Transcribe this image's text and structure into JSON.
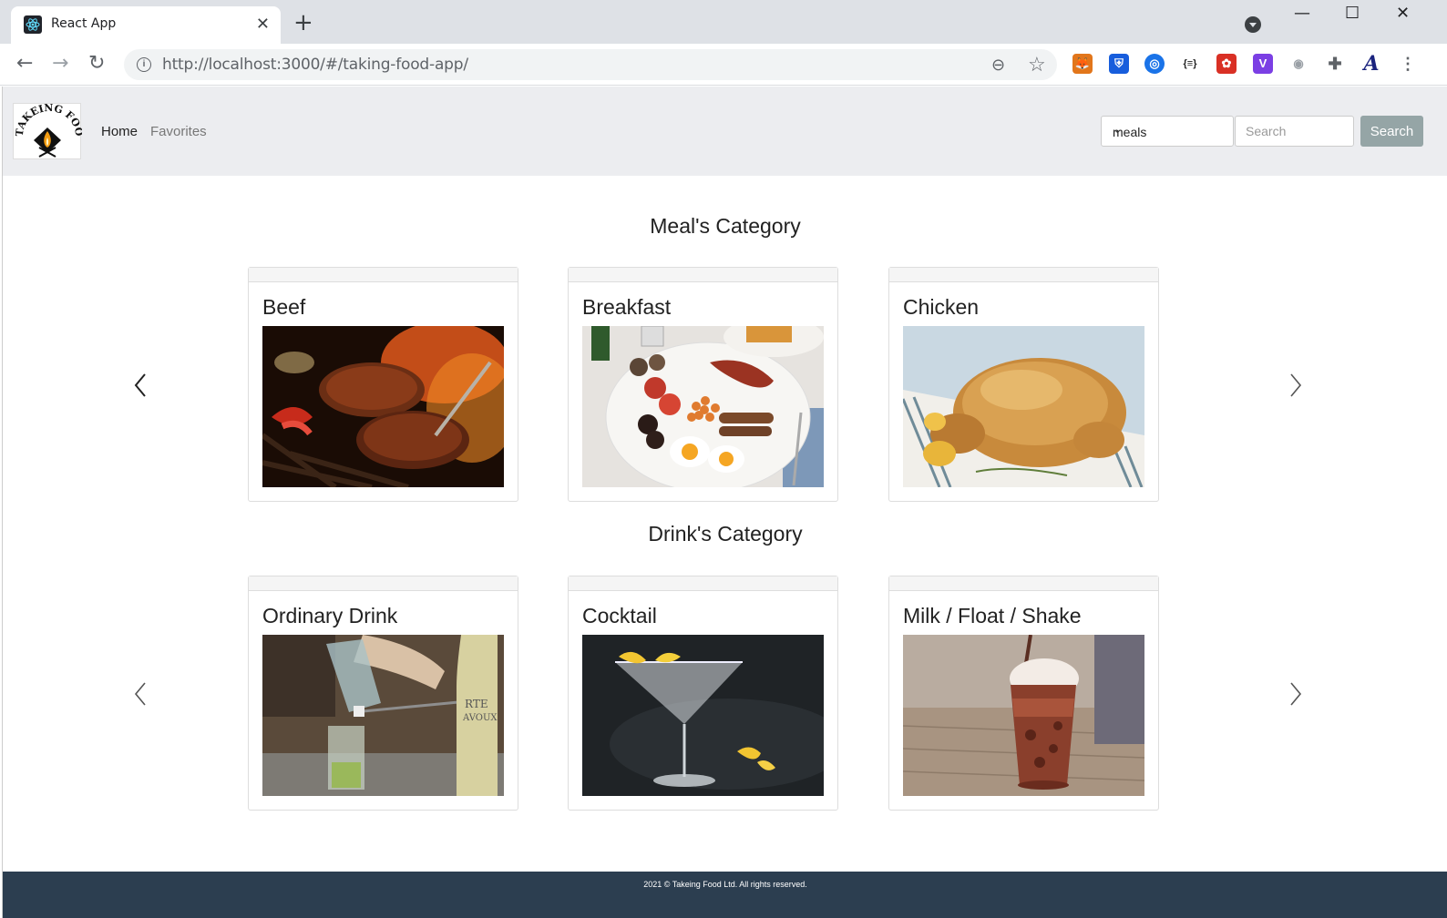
{
  "browser": {
    "tab_title": "React App",
    "tab_close": "✕",
    "new_tab": "+",
    "url": "http://localhost:3000/#/taking-food-app/",
    "win_min": "—",
    "win_max": "☐",
    "win_close": "✕"
  },
  "navbar": {
    "logo_text": "TAKEING FOOD",
    "home": "Home",
    "favorites": "Favorites",
    "select_value": "meals",
    "search_placeholder": "Search",
    "search_button": "Search"
  },
  "meals": {
    "title": "Meal's Category",
    "cards": [
      {
        "name": "Beef"
      },
      {
        "name": "Breakfast"
      },
      {
        "name": "Chicken"
      }
    ]
  },
  "drinks": {
    "title": "Drink's Category",
    "cards": [
      {
        "name": "Ordinary Drink"
      },
      {
        "name": "Cocktail"
      },
      {
        "name": "Milk / Float / Shake"
      }
    ]
  },
  "footer": {
    "text": "2021 © Takeing Food Ltd. All rights reserved."
  },
  "colors": {
    "navbar_bg": "#ecedf0",
    "footer_bg": "#2c3e50",
    "search_button": "#95a5a6"
  }
}
